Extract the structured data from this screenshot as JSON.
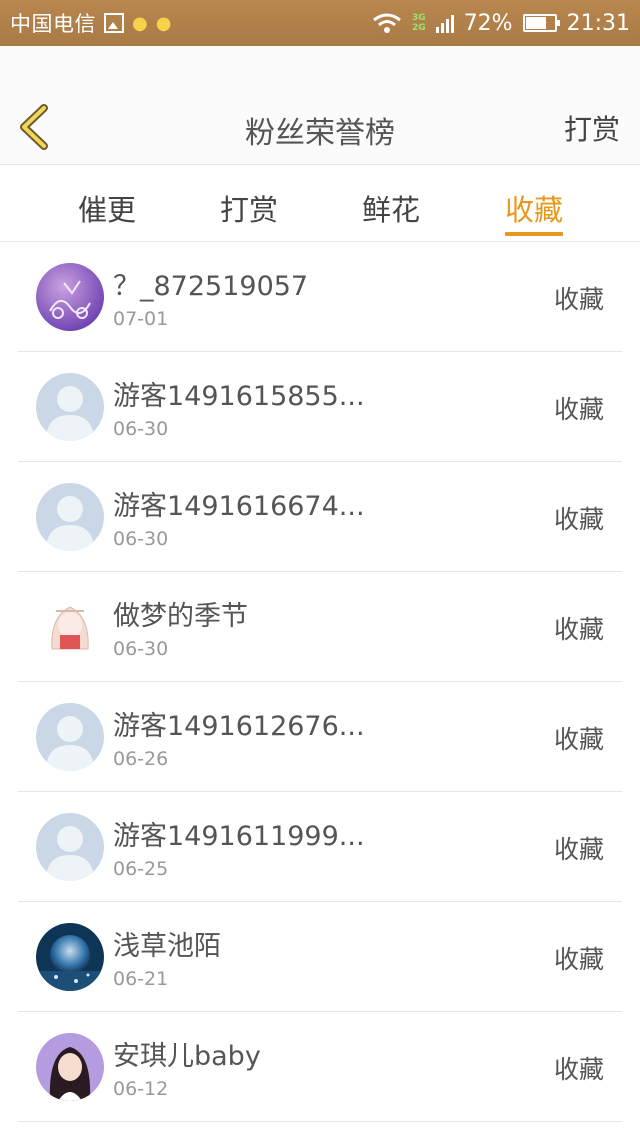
{
  "status_bar": {
    "carrier": "中国电信",
    "net_3g": "3G",
    "net_2g": "2G",
    "battery_percent": "72%",
    "battery_level": 0.72,
    "time": "21:31"
  },
  "header": {
    "title": "粉丝荣誉榜",
    "right_action": "打赏"
  },
  "tabs": [
    {
      "label": "催更",
      "active": false
    },
    {
      "label": "打赏",
      "active": false
    },
    {
      "label": "鲜花",
      "active": false
    },
    {
      "label": "收藏",
      "active": true
    }
  ],
  "accent_color": "#e8981d",
  "list": [
    {
      "name": "？_872519057",
      "date": "07-01",
      "action": "收藏",
      "avatar": "purple-doodle"
    },
    {
      "name": "游客1491615855...",
      "date": "06-30",
      "action": "收藏",
      "avatar": "default-user"
    },
    {
      "name": "游客1491616674...",
      "date": "06-30",
      "action": "收藏",
      "avatar": "default-user"
    },
    {
      "name": "做梦的季节",
      "date": "06-30",
      "action": "收藏",
      "avatar": "anime-girl"
    },
    {
      "name": "游客1491612676...",
      "date": "06-26",
      "action": "收藏",
      "avatar": "default-user"
    },
    {
      "name": "游客1491611999...",
      "date": "06-25",
      "action": "收藏",
      "avatar": "default-user"
    },
    {
      "name": "浅草池陌",
      "date": "06-21",
      "action": "收藏",
      "avatar": "blue-bubble"
    },
    {
      "name": "安琪儿baby",
      "date": "06-12",
      "action": "收藏",
      "avatar": "girl-photo"
    }
  ]
}
